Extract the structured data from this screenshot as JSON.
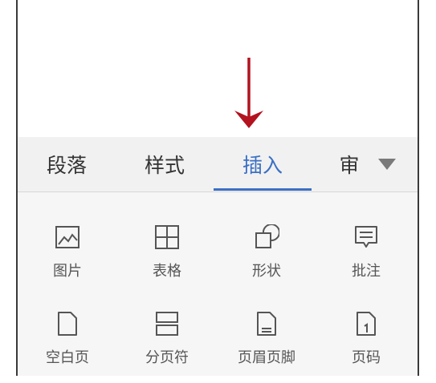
{
  "tabs": [
    {
      "label": "段落",
      "active": false
    },
    {
      "label": "样式",
      "active": false
    },
    {
      "label": "插入",
      "active": true
    },
    {
      "label": "审",
      "active": false
    }
  ],
  "insert_items": [
    {
      "label": "图片",
      "icon": "picture-icon"
    },
    {
      "label": "表格",
      "icon": "table-icon"
    },
    {
      "label": "形状",
      "icon": "shape-icon"
    },
    {
      "label": "批注",
      "icon": "comment-icon"
    },
    {
      "label": "空白页",
      "icon": "blank-page-icon"
    },
    {
      "label": "分页符",
      "icon": "page-break-icon"
    },
    {
      "label": "页眉页脚",
      "icon": "header-footer-icon"
    },
    {
      "label": "页码",
      "icon": "page-number-icon"
    }
  ],
  "colors": {
    "accent": "#3b6fc4",
    "arrow": "#b3121f",
    "icon_stroke": "#555555",
    "tabbar_bg": "#f1f1f1",
    "panel_bg": "#f6f6f6"
  }
}
